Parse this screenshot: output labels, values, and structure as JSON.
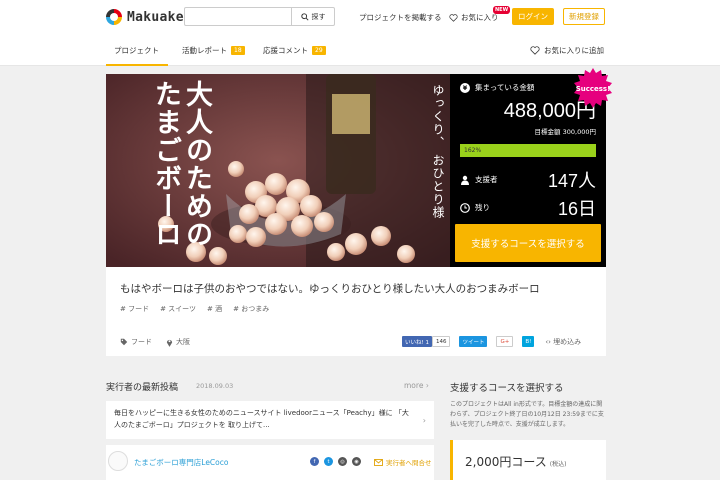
{
  "header": {
    "logo_text": "Makuake",
    "search_placeholder": "",
    "search_button": "探す",
    "post_project": "プロジェクトを掲載する",
    "favorites": "お気に入り",
    "new_badge": "NEW",
    "login": "ログイン",
    "signup": "新規登録"
  },
  "tabs": {
    "project": "プロジェクト",
    "report": "活動レポート",
    "report_count": "18",
    "comments": "応援コメント",
    "comments_count": "29",
    "add_favorite": "お気に入りに追加"
  },
  "hero": {
    "title_line1": "大人のための",
    "title_line2": "たまごボーロ",
    "sub_line1": "ゆっくり、",
    "sub_line2": "おひとり様"
  },
  "stats": {
    "raised_label": "集まっている金額",
    "raised_amount": "488,000円",
    "goal": "目標金額 300,000円",
    "progress_label": "162%",
    "progress_fraction": 1.0,
    "backers_label": "支援者",
    "backers_value": "147人",
    "remaining_label": "残り",
    "remaining_value": "16日",
    "success_badge": "Success!",
    "support_button": "支援するコースを選択する"
  },
  "project": {
    "title": "もはやボーロは子供のおやつではない。ゆっくりおひとり様したい大人のおつまみボーロ",
    "tags": [
      "# フード",
      "# スイーツ",
      "# 酒",
      "# おつまみ"
    ],
    "category": "フード",
    "location": "大阪",
    "fb_like": "いいね! 1",
    "fb_count": "146",
    "tweet": "ツイート",
    "gplus": "G+",
    "hatena": "B!",
    "embed": "埋め込み"
  },
  "news": {
    "heading": "実行者の最新投稿",
    "date": "2018.09.03",
    "more": "more",
    "body": "毎日をハッピーに生きる女性のためのニュースサイト livedoorニュース「Peachy」様に 「大人のたまごボーロ」プロジェクトを 取り上げて..."
  },
  "owner": {
    "name": "たまごボーロ専門店LeCoco",
    "contact": "実行者へ問合せ"
  },
  "course": {
    "heading": "支援するコースを選択する",
    "desc": "このプロジェクトはAll in形式です。目標金額の達成に関わらず、プロジェクト終了日の10月12日 23:59までに支払いを完了した時点で、支援が成立します。",
    "price": "2,000円コース",
    "tax": "(税込)"
  },
  "colors": {
    "brand": "#f8b500",
    "success": "#e6007e",
    "progress": "#9ad11b",
    "link": "#2b9fd6"
  }
}
